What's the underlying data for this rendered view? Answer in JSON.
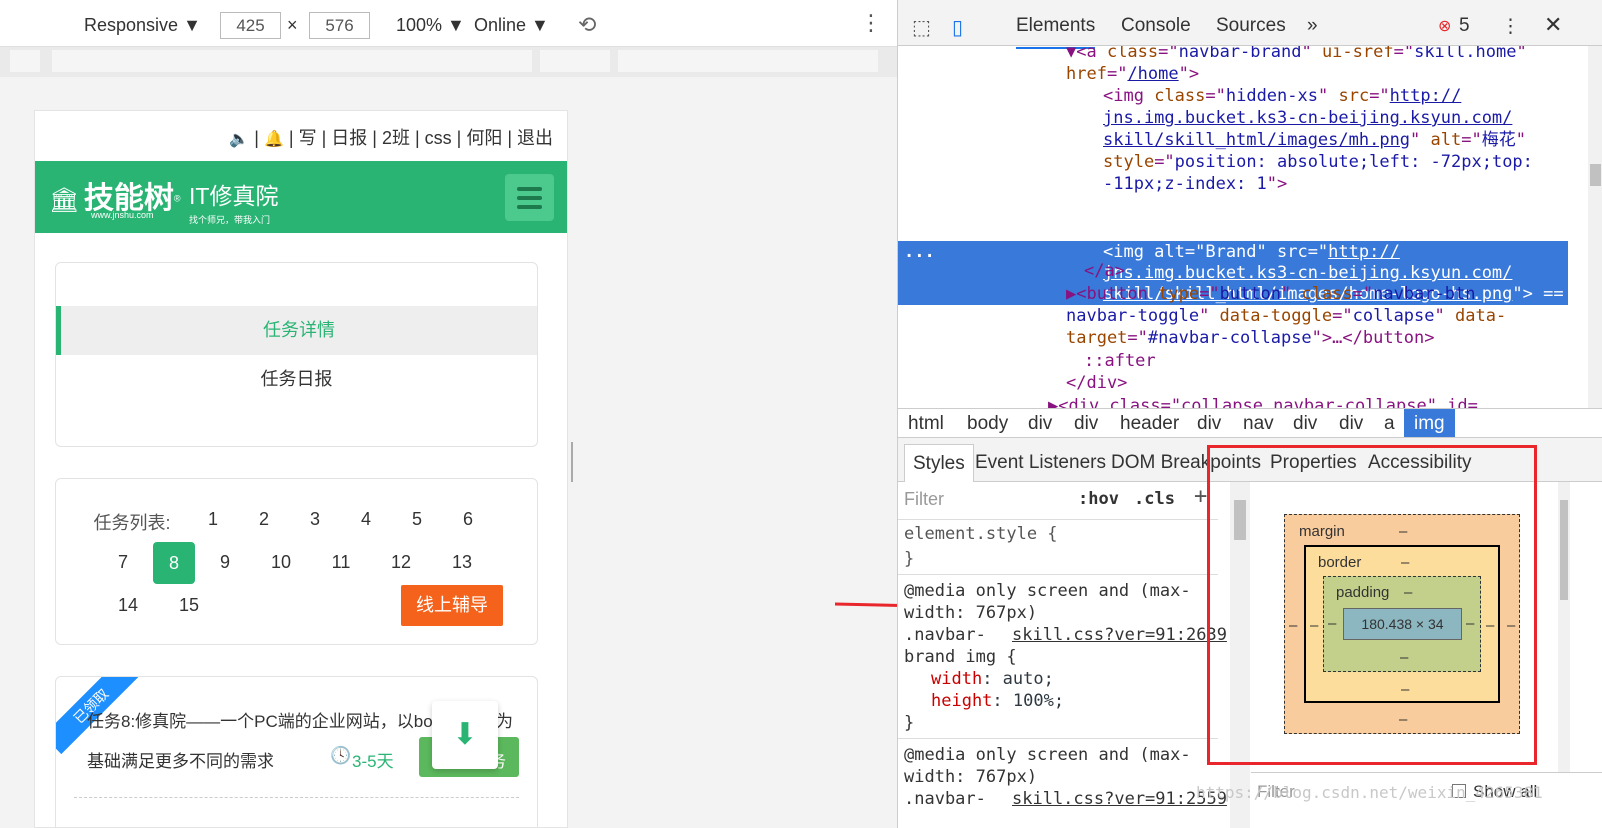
{
  "device_toolbar": {
    "device": "Responsive",
    "width": "425",
    "times": "×",
    "height": "576",
    "zoom": "100%",
    "network": "Online"
  },
  "mobile": {
    "top_links": "| 写 | 日报 | 2班 | css | 何阳 | 退出",
    "brand_main": "技能树",
    "brand_reg": "®",
    "brand_sub": "www.jnshu.com",
    "brand2_main": "IT修真院",
    "brand2_sub": "找个师兄，带我入门",
    "tabs": [
      "任务详情",
      "任务日报"
    ],
    "tasklist_label": "任务列表:",
    "row1": [
      "1",
      "2",
      "3",
      "4",
      "5",
      "6"
    ],
    "row2": [
      "7",
      "8",
      "9",
      "10",
      "11",
      "12",
      "13"
    ],
    "row3": [
      "14",
      "15"
    ],
    "current": "8",
    "tutor_button": "线上辅导",
    "ribbon": "已领取",
    "task_line1": "任务8:修真院——一个PC端的企业网站，以bo",
    "task_line1_tail": "为",
    "task_line2": "基础满足更多不同的需求",
    "duration": "3-5天",
    "task_button_tail": "务"
  },
  "devtools": {
    "tabs": [
      "Elements",
      "Console",
      "Sources"
    ],
    "error_count": "5",
    "code": {
      "l1a": "▼<a ",
      "l1b": "class",
      "l1c": "=\"",
      "l1d": "navbar-brand",
      "l1e": "\" ",
      "l1f": "ui-sref",
      "l1g": "=\"",
      "l1h": "skill.home",
      "l1i": "\"",
      "l2a": "href",
      "l2b": "=\"",
      "l2c": "/home",
      "l2d": "\">",
      "l3a": "<img ",
      "l3b": "class",
      "l3c": "=\"",
      "l3d": "hidden-xs",
      "l3e": "\" ",
      "l3f": "src",
      "l3g": "=\"",
      "l3h": "http://",
      "l4": "jns.img.bucket.ks3-cn-beijing.ksyun.com/",
      "l5a": "skill/skill_html/images/mh.png",
      "l5b": "\" ",
      "l5c": "alt",
      "l5d": "=\"",
      "l5e": "梅花",
      "l5f": "\"",
      "l6a": "style",
      "l6b": "=\"",
      "l6c": "position: absolute;left: -72px;top:",
      "l7a": "-11px;z-index: 1",
      "l7b": "\">",
      "s1": "<img alt=\"Brand\" src=\"",
      "s1b": "http://",
      "s2": "jns.img.bucket.ks3-cn-beijing.ksyun.com/",
      "s3": "skill/skill_html/images/home-logo-hs.png",
      "s3b": "\"> ==",
      "dots": "...",
      "l8": "</a>",
      "l9a": "▶<button ",
      "l9b": "type",
      "l9c": "=\"",
      "l9d": "button",
      "l9e": "\" ",
      "l9f": "class",
      "l9g": "=\"",
      "l9h": "navbar-btn",
      "l10a": "navbar-toggle",
      "l10b": "\" ",
      "l10c": "data-toggle",
      "l10d": "=\"",
      "l10e": "collapse",
      "l10f": "\" ",
      "l10g": "data-",
      "l11a": "target",
      "l11b": "=\"",
      "l11c": "#navbar-collapse",
      "l11d": "\">…</button>",
      "l12": "::after",
      "l13": "</div>",
      "l14": "▶<div class=\"collapse navbar-collapse\" id="
    },
    "breadcrumbs": [
      "html",
      "body",
      "div",
      "div",
      "header",
      "div",
      "nav",
      "div",
      "div",
      "a",
      "img"
    ],
    "subtabs": [
      "Styles",
      "Event Listeners",
      "DOM Breakpoints",
      "Properties",
      "Accessibility"
    ],
    "filter": "Filter",
    "hov": ":hov",
    "cls": ".cls",
    "styles": {
      "es": "element.style {",
      "es_close": "}",
      "m1": "@media only screen and (max-",
      "m1b": "width: 767px)",
      "sel1": ".navbar-",
      "src1": "skill.css?ver=91:2639",
      "sel1b": "brand img {",
      "p1": "width",
      "v1": "auto;",
      "p2": "height",
      "v2": "100%;",
      "close": "}",
      "m2": "@media only screen and (max-",
      "m2b": "width: 767px)",
      "sel2": ".navbar-",
      "src2": "skill.css?ver=91:2559"
    },
    "boxmodel": {
      "margin": "margin",
      "border": "border",
      "padding": "padding",
      "dash": "–",
      "content": "180.438 × 34"
    },
    "bottom_filter": "Filter",
    "show_all": "Show all"
  },
  "watermark": "https://blog.csdn.net/weixin_4265381",
  "colors": {
    "green": "#29b474",
    "orange": "#f5621b",
    "selection": "#3879d9",
    "annotation": "#e8262b"
  }
}
